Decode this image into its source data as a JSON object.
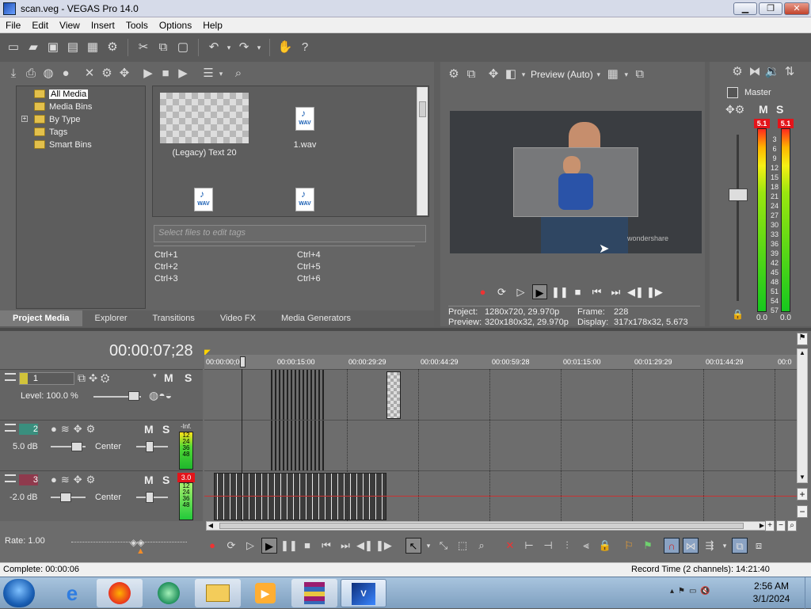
{
  "window": {
    "title": "scan.veg - VEGAS Pro 14.0",
    "min": "▁",
    "max": "❐",
    "close": "✕"
  },
  "menu": [
    "File",
    "Edit",
    "View",
    "Insert",
    "Tools",
    "Options",
    "Help"
  ],
  "media": {
    "tree": [
      "All Media",
      "Media Bins",
      "By Type",
      "Tags",
      "Smart Bins"
    ],
    "files": [
      {
        "name": "(Legacy) Text 20"
      },
      {
        "name": "1.wav"
      },
      {
        "name": ""
      },
      {
        "name": ""
      }
    ],
    "wav_tag": "WAV",
    "tag_placeholder": "Select files to edit tags",
    "shortcuts": [
      "Ctrl+1",
      "Ctrl+2",
      "Ctrl+3",
      "Ctrl+4",
      "Ctrl+5",
      "Ctrl+6"
    ],
    "tabs": [
      "Project Media",
      "Explorer",
      "Transitions",
      "Video FX",
      "Media Generators"
    ]
  },
  "preview": {
    "mode": "Preview (Auto)",
    "project_label": "Project:",
    "project": "1280x720, 29.970p",
    "preview_label": "Preview:",
    "preview": "320x180x32, 29.970p",
    "frame_label": "Frame:",
    "frame": "228",
    "display_label": "Display:",
    "display": "317x178x32, 5.673",
    "watermark": "wondershare"
  },
  "master": {
    "label": "Master",
    "m": "M",
    "s": "S",
    "peak_left": "5.1",
    "peak_right": "5.1",
    "scale": [
      "3",
      "6",
      "9",
      "12",
      "15",
      "18",
      "21",
      "24",
      "27",
      "30",
      "33",
      "36",
      "39",
      "42",
      "45",
      "48",
      "51",
      "54",
      "57"
    ],
    "bottom_left": "0.0",
    "bottom_right": "0.0"
  },
  "timeline": {
    "time": "00:00:07;28",
    "ruler": [
      "00:00:00;00",
      "00:00:15:00",
      "00:00:29:29",
      "00:00:44:29",
      "00:00:59:28",
      "00:01:15:00",
      "00:01:29:29",
      "00:01:44:29",
      "00:0"
    ],
    "tracks": [
      {
        "num": "1",
        "level": "Level: 100.0 %",
        "m": "M",
        "s": "S"
      },
      {
        "num": "2",
        "vol": "5.0 dB",
        "pan": "Center",
        "m": "M",
        "s": "S",
        "meter_top": "-Inf.",
        "meter": [
          "12",
          "24",
          "36",
          "48"
        ]
      },
      {
        "num": "3",
        "vol": "-2.0 dB",
        "pan": "Center",
        "m": "M",
        "s": "S",
        "meter_top": "3.0",
        "meter": [
          "12",
          "24",
          "36",
          "48"
        ]
      }
    ],
    "rate": "Rate: 1.00"
  },
  "status": {
    "left": "Complete: 00:00:06",
    "right": "Record Time (2 channels): 14:21:40"
  },
  "clock": {
    "time": "2:56 AM",
    "date": "3/1/2024"
  }
}
